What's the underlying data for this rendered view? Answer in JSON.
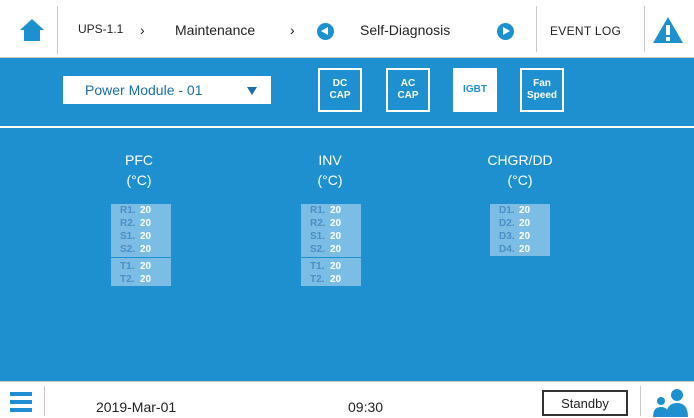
{
  "breadcrumb": {
    "device": "UPS-1.1",
    "section": "Maintenance",
    "page": "Self-Diagnosis"
  },
  "event_log_label": "EVENT LOG",
  "module_select": {
    "value": "Power Module - 01"
  },
  "tabs": [
    {
      "line1": "DC",
      "line2": "CAP",
      "active": false
    },
    {
      "line1": "AC",
      "line2": "CAP",
      "active": false
    },
    {
      "line1": "IGBT",
      "line2": "",
      "active": true
    },
    {
      "line1": "Fan",
      "line2": "Speed",
      "active": false
    }
  ],
  "groups": [
    {
      "title": "PFC",
      "unit": "(°C)",
      "items": [
        {
          "label": "R1.",
          "value": "20"
        },
        {
          "label": "R2.",
          "value": "20"
        },
        {
          "label": "S1.",
          "value": "20"
        },
        {
          "label": "S2.",
          "value": "20"
        },
        {
          "label": "T1.",
          "value": "20"
        },
        {
          "label": "T2.",
          "value": "20"
        }
      ]
    },
    {
      "title": "INV",
      "unit": "(°C)",
      "items": [
        {
          "label": "R1.",
          "value": "20"
        },
        {
          "label": "R2.",
          "value": "20"
        },
        {
          "label": "S1.",
          "value": "20"
        },
        {
          "label": "S2.",
          "value": "20"
        },
        {
          "label": "T1.",
          "value": "20"
        },
        {
          "label": "T2.",
          "value": "20"
        }
      ]
    },
    {
      "title": "CHGR/DD",
      "unit": "(°C)",
      "items": [
        {
          "label": "D1.",
          "value": "20"
        },
        {
          "label": "D2.",
          "value": "20"
        },
        {
          "label": "D3.",
          "value": "20"
        },
        {
          "label": "D4.",
          "value": "20"
        }
      ]
    }
  ],
  "status": {
    "date": "2019-Mar-01",
    "time": "09:30",
    "mode": "Standby"
  },
  "colors": {
    "accent": "#1e90d0",
    "cell_bg": "#7bbde4",
    "warning": "#1e90d0"
  }
}
